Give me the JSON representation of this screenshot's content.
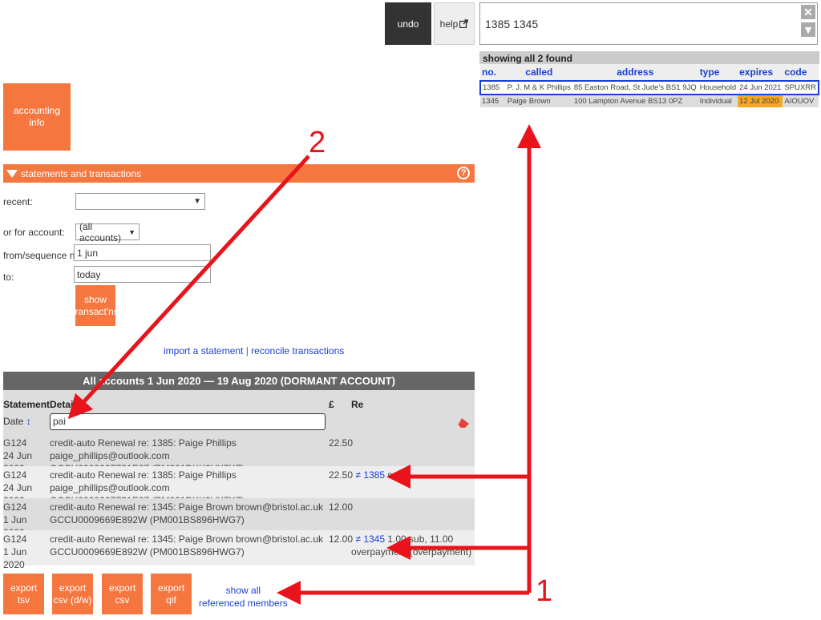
{
  "toolbar": {
    "undo_label": "undo",
    "help_label": "help"
  },
  "search": {
    "value": "1385 1345"
  },
  "results": {
    "summary": "showing all 2 found",
    "columns": [
      "no.",
      "called",
      "address",
      "type",
      "expires",
      "code"
    ],
    "rows": [
      {
        "no": "1385",
        "called": "P. J. M & K Phillips",
        "address": "85 Easton Road, St Jude's BS1 9JQ",
        "type": "Household",
        "expires": "24 Jun 2021",
        "code": "SPUXRR"
      },
      {
        "no": "1345",
        "called": "Paige Brown",
        "address": "100 Lampton Avenue BS13 0PZ",
        "type": "Individual",
        "expires": "12 Jul 2020",
        "code": "AIOUOV"
      }
    ]
  },
  "accounting_info": {
    "label_line1": "accounting",
    "label_line2": "info"
  },
  "statements": {
    "section_title": "statements and transactions",
    "recent_label": "recent:",
    "recent_value": "",
    "account_label": "or for account:",
    "account_value": "(all accounts)",
    "from_label": "from/sequence no:",
    "from_value": "1 jun",
    "to_label": "to:",
    "to_value": "today",
    "show_btn_line1": "show",
    "show_btn_line2": "transact'ns",
    "import_link": "import a statement",
    "link_sep": "|",
    "reconcile_link": "reconcile transactions"
  },
  "transactions": {
    "title": "All accounts 1 Jun 2020 — 19 Aug 2020 (DORMANT ACCOUNT)",
    "col_statement": "Statement",
    "col_details": "Details",
    "col_amount": "£",
    "col_re": "Re",
    "date_label": "Date",
    "filter_value": "pai",
    "rows": [
      {
        "stmt": "G124",
        "date": "24 Jun 2020",
        "detail1": "credit-auto Renewal re: 1385: Paige Phillips paige_phillips@outlook.com",
        "detail2": "GCCU0009667Z31E67 (PM001DKK9VX7KZ)",
        "amount": "22.50",
        "neq": "",
        "ref": "",
        "re": "",
        "re2": ""
      },
      {
        "stmt": "G124",
        "date": "24 Jun 2020",
        "detail1": "credit-auto Renewal re: 1385: Paige Phillips paige_phillips@outlook.com",
        "detail2": "GCCU0009667Z31E67 (PM001DKK9VX7KZ)",
        "amount": "22.50",
        "neq": "≠",
        "ref": "1385",
        "re": "sub",
        "re2": ""
      },
      {
        "stmt": "G124",
        "date": "1 Jun 2020",
        "detail1": "credit-auto Renewal re: 1345: Paige Brown brown@bristol.ac.uk",
        "detail2": "GCCU0009669E892W (PM001BS896HWG7)",
        "amount": "12.00",
        "neq": "",
        "ref": "",
        "re": "",
        "re2": ""
      },
      {
        "stmt": "G124",
        "date": "1 Jun 2020",
        "detail1": "credit-auto Renewal re: 1345: Paige Brown brown@bristol.ac.uk",
        "detail2": "GCCU0009669E892W (PM001BS896HWG7)",
        "amount": "12.00",
        "neq": "≠",
        "ref": "1345",
        "re": "1.00 sub, 11.00",
        "re2": "overpayment (overpayment)"
      }
    ]
  },
  "exports": [
    {
      "line1": "export",
      "line2": "tsv"
    },
    {
      "line1": "export",
      "line2": "csv (d/w)"
    },
    {
      "line1": "export",
      "line2": "csv"
    },
    {
      "line1": "export",
      "line2": "qif"
    }
  ],
  "show_all": {
    "line1": "show all",
    "line2": "referenced members"
  },
  "annotations": {
    "num1": "1",
    "num2": "2",
    "arrow_color": "#e8131b"
  },
  "colors": {
    "accent": "#f5773f",
    "link": "#1a3fd6",
    "highlight": "#f5a623"
  }
}
